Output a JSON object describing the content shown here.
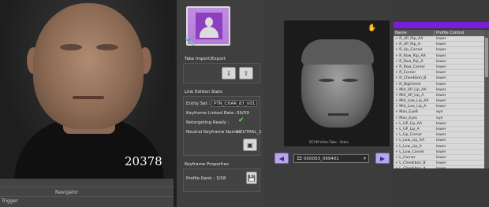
{
  "viewport": {
    "frame_number": "20378"
  },
  "timeline": {
    "navigator_label": "Navigator",
    "trigger_label": "Trigger"
  },
  "take_panel": {
    "import_export_label": "Take Import/Export",
    "link_edition_label": "Link Edition Stats",
    "entity_set_label": "Entity Set :",
    "entity_set_value": "PTN_CHAR_87_V01",
    "keyframe_rate_label": "Keyframe Linked Rate :",
    "keyframe_rate_value": "39/59",
    "retargeting_label": "Retargeting Ready :",
    "neutral_label": "Neutral Keyframe Name :",
    "neutral_value": "NEUTRAL_1",
    "keyframe_props_label": "Keyframe Properties",
    "profile_rank_label": "Profile Rank :",
    "profile_rank_value": "3/58"
  },
  "video": {
    "caption": "DCAM Video Take : Video",
    "take_name": "000003_099401"
  },
  "control_list": {
    "col_name": "Name",
    "col_profile": "Profile Control",
    "rows": [
      {
        "name": "R_UP_Rip_AA",
        "profile": "lower"
      },
      {
        "name": "R_UP_Rip_A",
        "profile": "lower"
      },
      {
        "name": "R_Up_Corner",
        "profile": "lower"
      },
      {
        "name": "R_Row_Rip_AA",
        "profile": "lower"
      },
      {
        "name": "R_Row_Rip_A",
        "profile": "lower"
      },
      {
        "name": "R_Row_Corner",
        "profile": "lower"
      },
      {
        "name": "R_Corner",
        "profile": "lower"
      },
      {
        "name": "R_Cheekbon_B",
        "profile": "lower"
      },
      {
        "name": "R_BigCheek",
        "profile": "lower"
      },
      {
        "name": "Mid_UP_Lip_AA",
        "profile": "lower"
      },
      {
        "name": "Mid_UP_Lip_A",
        "profile": "lower"
      },
      {
        "name": "Mid_Low_Lip_AA",
        "profile": "lower"
      },
      {
        "name": "Mid_Low_Lip_A",
        "profile": "lower"
      },
      {
        "name": "Man_EyeR",
        "profile": "eye"
      },
      {
        "name": "Man_EyeL",
        "profile": "eye"
      },
      {
        "name": "L_UP_Lip_AA",
        "profile": "lower"
      },
      {
        "name": "L_UP_Lip_A",
        "profile": "lower"
      },
      {
        "name": "L_Up_Corner",
        "profile": "lower"
      },
      {
        "name": "L_Low_Lip_AA",
        "profile": "lower"
      },
      {
        "name": "L_Low_Lip_A",
        "profile": "lower"
      },
      {
        "name": "L_Low_Corner",
        "profile": "lower"
      },
      {
        "name": "L_Corner",
        "profile": "lower"
      },
      {
        "name": "L_Cheekbon_B",
        "profile": "lower"
      },
      {
        "name": "L_Cheekbon_A",
        "profile": "lower"
      },
      {
        "name": "L_BigCheek",
        "profile": "upper",
        "selected": true
      }
    ]
  }
}
